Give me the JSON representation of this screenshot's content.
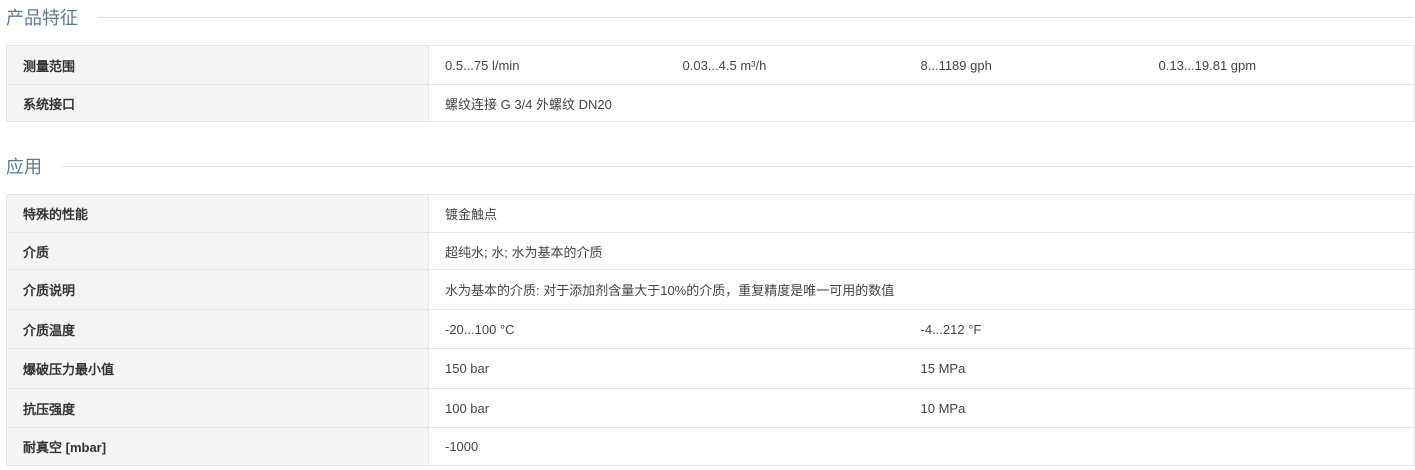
{
  "sections": {
    "features": {
      "title": "产品特征",
      "rows": [
        {
          "label": "测量范围",
          "values": [
            "0.5...75 l/min",
            "0.03...4.5 m³/h",
            "8...1189 gph",
            "0.13...19.81 gpm"
          ]
        },
        {
          "label": "系统接口",
          "values": [
            "螺纹连接 G 3/4 外螺纹 DN20"
          ]
        }
      ]
    },
    "application": {
      "title": "应用",
      "rows": [
        {
          "label": "特殊的性能",
          "values": [
            "镀金触点"
          ]
        },
        {
          "label": "介质",
          "values": [
            "超纯水; 水; 水为基本的介质"
          ]
        },
        {
          "label": "介质说明",
          "values": [
            "水为基本的介质: 对于添加剂含量大于10%的介质，重复精度是唯一可用的数值"
          ]
        },
        {
          "label": "介质温度",
          "values": [
            "-20...100 °C",
            "-4...212 °F"
          ]
        },
        {
          "label": "爆破压力最小值",
          "values": [
            "150 bar",
            "15 MPa"
          ]
        },
        {
          "label": "抗压强度",
          "values": [
            "100 bar",
            "10 MPa"
          ]
        },
        {
          "label": "耐真空 [mbar]",
          "values": [
            "-1000"
          ]
        }
      ]
    }
  }
}
